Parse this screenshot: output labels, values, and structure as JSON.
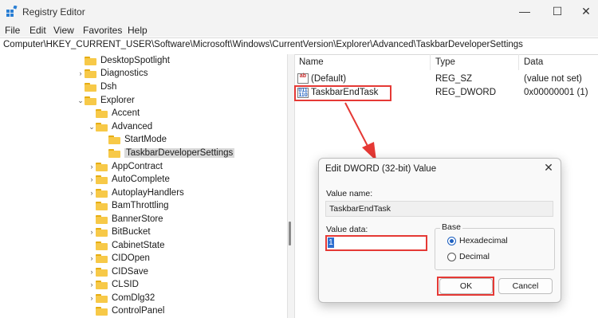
{
  "window": {
    "title": "Registry Editor",
    "minimize": "—",
    "maximize": "☐",
    "close": "✕"
  },
  "menu": [
    "File",
    "Edit",
    "View",
    "Favorites",
    "Help"
  ],
  "address": "Computer\\HKEY_CURRENT_USER\\Software\\Microsoft\\Windows\\CurrentVersion\\Explorer\\Advanced\\TaskbarDeveloperSettings",
  "tree": [
    {
      "label": "DesktopSpotlight",
      "chevron": ""
    },
    {
      "label": "Diagnostics",
      "chevron": "›"
    },
    {
      "label": "Dsh",
      "chevron": ""
    },
    {
      "label": "Explorer",
      "chevron": "⌄"
    },
    {
      "label": "Accent",
      "chevron": ""
    },
    {
      "label": "Advanced",
      "chevron": "⌄"
    },
    {
      "label": "StartMode",
      "chevron": ""
    },
    {
      "label": "TaskbarDeveloperSettings",
      "chevron": "",
      "selected": true
    },
    {
      "label": "AppContract",
      "chevron": "›"
    },
    {
      "label": "AutoComplete",
      "chevron": "›"
    },
    {
      "label": "AutoplayHandlers",
      "chevron": "›"
    },
    {
      "label": "BamThrottling",
      "chevron": ""
    },
    {
      "label": "BannerStore",
      "chevron": ""
    },
    {
      "label": "BitBucket",
      "chevron": "›"
    },
    {
      "label": "CabinetState",
      "chevron": ""
    },
    {
      "label": "CIDOpen",
      "chevron": "›"
    },
    {
      "label": "CIDSave",
      "chevron": "›"
    },
    {
      "label": "CLSID",
      "chevron": "›"
    },
    {
      "label": "ComDlg32",
      "chevron": "›"
    },
    {
      "label": "ControlPanel",
      "chevron": ""
    }
  ],
  "list": {
    "headers": {
      "name": "Name",
      "type": "Type",
      "data": "Data"
    },
    "rows": [
      {
        "icon": "ab",
        "name": "(Default)",
        "type": "REG_SZ",
        "data": "(value not set)"
      },
      {
        "icon": "dword",
        "name": "TaskbarEndTask",
        "type": "REG_DWORD",
        "data": "0x00000001 (1)"
      }
    ]
  },
  "dialog": {
    "title": "Edit DWORD (32-bit) Value",
    "close": "✕",
    "value_name_label": "Value name:",
    "value_name": "TaskbarEndTask",
    "value_data_label": "Value data:",
    "value_data": "1",
    "base_label": "Base",
    "hex_label": "Hexadecimal",
    "dec_label": "Decimal",
    "selected_base": "Hexadecimal",
    "ok": "OK",
    "cancel": "Cancel"
  },
  "colors": {
    "highlight": "#e53935",
    "folder": "#f7c948",
    "selection": "#2f6fd0"
  },
  "icons": [
    "registry-app-icon",
    "folder-icon",
    "string-value-icon",
    "dword-value-icon",
    "red-arrow"
  ]
}
